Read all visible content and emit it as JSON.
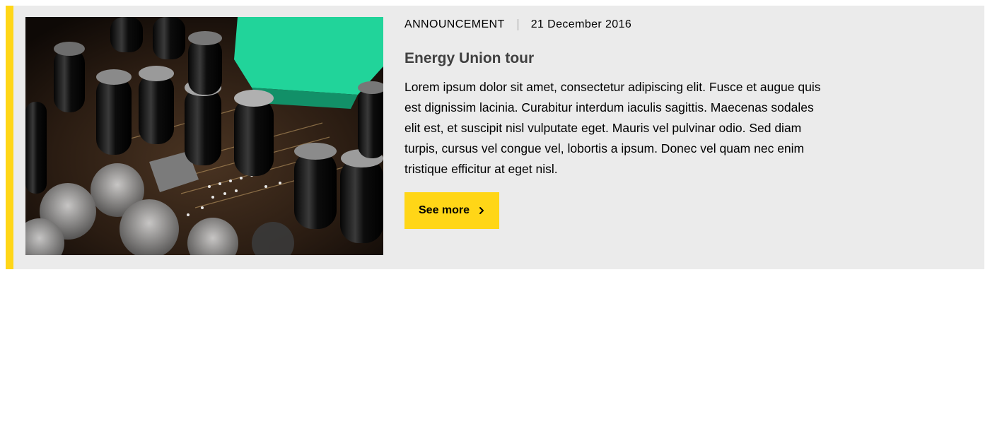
{
  "article": {
    "category": "ANNOUNCEMENT",
    "date": "21 December 2016",
    "title": "Energy Union tour",
    "body": "Lorem ipsum dolor sit amet, consectetur adipiscing elit. Fusce et augue quis est dignissim lacinia. Curabitur interdum iaculis sagittis. Maecenas sodales elit est, et suscipit nisl vulputate eget. Mauris vel pulvinar odio. Sed diam turpis, cursus vel congue vel, lobortis a ipsum. Donec vel quam nec enim tristique efficitur at eget nisl.",
    "button_label": "See more",
    "button_icon": "chevron-right-icon",
    "image_icon": "circuit-board-image"
  },
  "colors": {
    "accent": "#ffd617",
    "card_bg": "#ebebeb",
    "title": "#404040"
  }
}
